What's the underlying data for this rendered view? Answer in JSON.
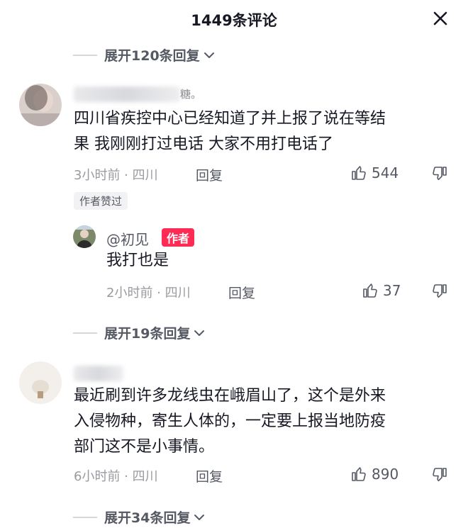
{
  "header": {
    "title": "1449条评论",
    "close_icon": "close-icon"
  },
  "expand_top": {
    "label": "展开120条回复"
  },
  "comment1": {
    "username_tail": "糖。",
    "text_line1": "四川省疾控中心已经知道了并上报了说在等结",
    "text_line2": "果 我刚刚打过电话 大家不用打电话了",
    "meta": "3小时前 · 四川",
    "reply_label": "回复",
    "likes": "544",
    "author_liked": "作者赞过"
  },
  "reply1": {
    "name": "@初见",
    "author_tag": "作者",
    "text": "我打也是",
    "meta": "2小时前 · 四川",
    "reply_label": "回复",
    "likes": "37"
  },
  "expand_mid": {
    "label": "展开19条回复"
  },
  "comment2": {
    "text_line1": "最近刷到许多龙线虫在峨眉山了，这个是外来",
    "text_line2": "入侵物种，寄生人体的，一定要上报当地防疫",
    "text_line3": "部门这不是小事情。",
    "meta": "6小时前 · 四川",
    "reply_label": "回复",
    "likes": "890"
  },
  "expand_bottom": {
    "label": "展开34条回复"
  },
  "colors": {
    "author_tag": "#fe2c55",
    "text": "#161823",
    "muted": "#9a9ba1"
  }
}
